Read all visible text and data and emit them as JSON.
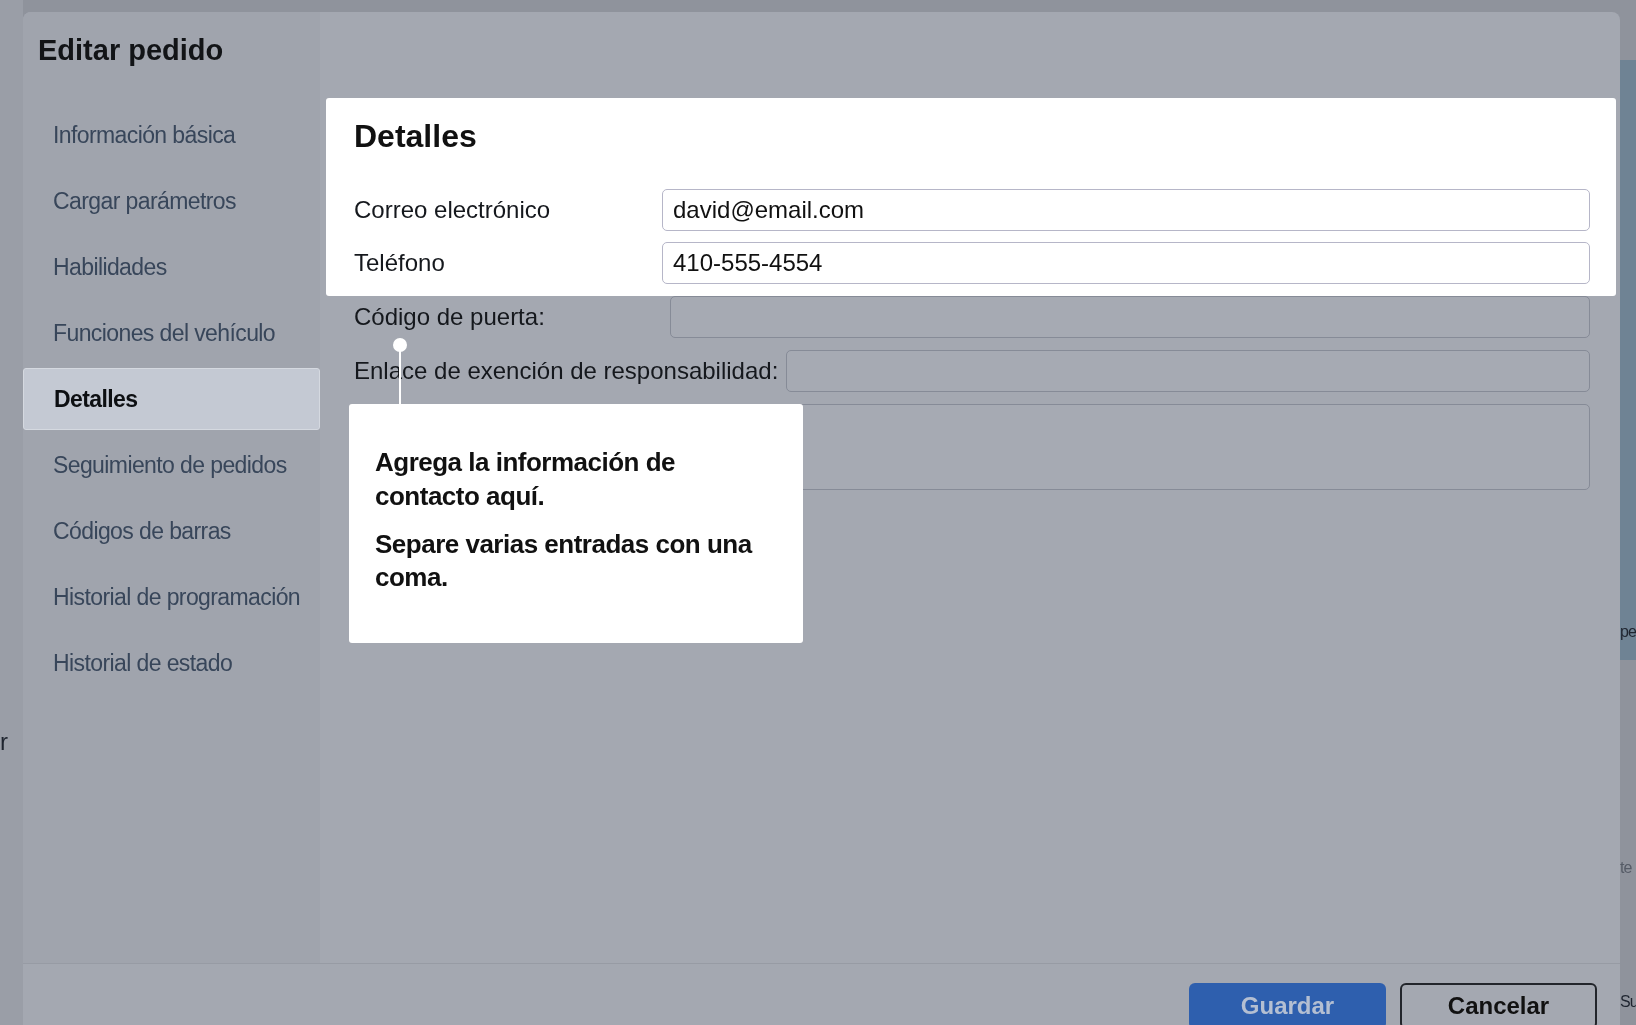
{
  "background_fragments": [
    {
      "text": "r"
    },
    {
      "text": "pe"
    },
    {
      "text": "te"
    },
    {
      "text": "Su"
    }
  ],
  "dialog": {
    "title": "Editar pedido",
    "sidebar": {
      "items": [
        {
          "label": "Información básica",
          "selected": false
        },
        {
          "label": "Cargar parámetros",
          "selected": false
        },
        {
          "label": "Habilidades",
          "selected": false
        },
        {
          "label": "Funciones del vehículo",
          "selected": false
        },
        {
          "label": "Detalles",
          "selected": true
        },
        {
          "label": "Seguimiento de pedidos",
          "selected": false
        },
        {
          "label": "Códigos de barras",
          "selected": false
        },
        {
          "label": "Historial de programación",
          "selected": false
        },
        {
          "label": "Historial de estado",
          "selected": false
        }
      ]
    },
    "highlighted_section": {
      "heading": "Detalles",
      "fields": [
        {
          "kind": "input",
          "label": "Correo electrónico",
          "value": "david@email.com"
        },
        {
          "kind": "input",
          "label": "Teléfono",
          "value": "410-555-4554"
        }
      ]
    },
    "dimmed_fields": [
      {
        "kind": "input",
        "label": "Código de puerta:"
      },
      {
        "kind": "input",
        "label": "Enlace de exención de responsabilidad:"
      },
      {
        "kind": "textarea"
      }
    ],
    "buttons": [
      {
        "kind": "primary",
        "label": "Guardar"
      },
      {
        "kind": "secondary",
        "label": "Cancelar"
      }
    ]
  },
  "tooltip": {
    "paragraphs": [
      "Agrega la información de contacto aquí.",
      "Separe varias entradas con una coma."
    ]
  }
}
